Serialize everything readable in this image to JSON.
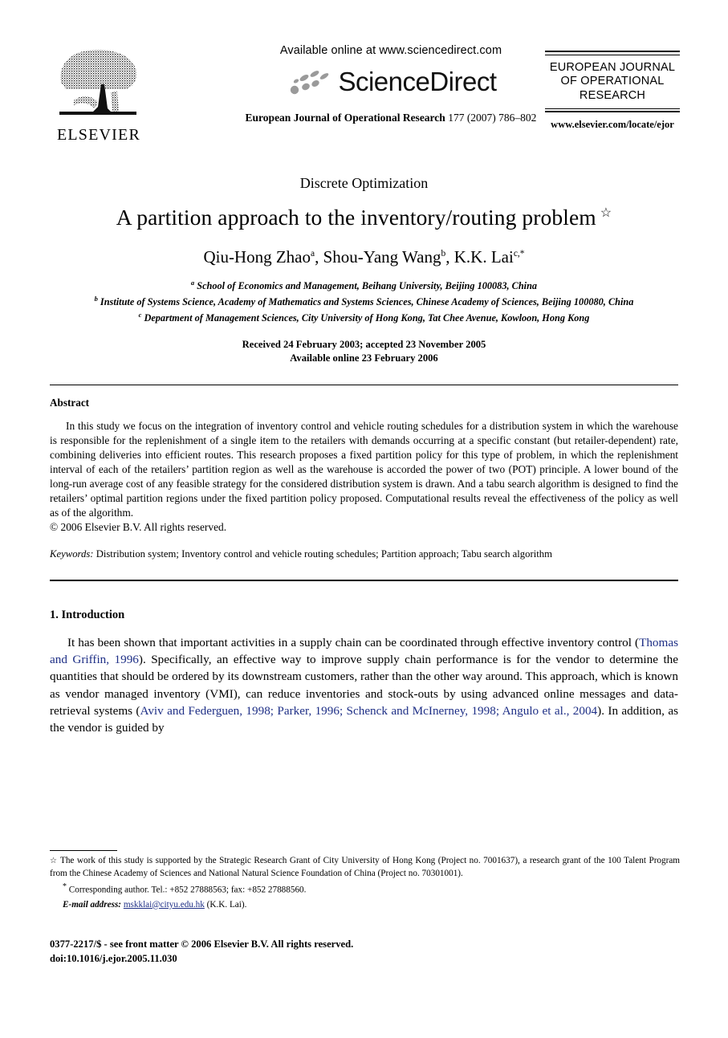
{
  "masthead": {
    "publisher_logo_name": "elsevier-tree-logo",
    "publisher_word": "ELSEVIER",
    "available_online": "Available online at www.sciencedirect.com",
    "sciencedirect_word": "ScienceDirect",
    "journal_ref_name": "European Journal of Operational Research",
    "journal_ref_vol": "177 (2007) 786–802",
    "journal_box_title": "EUROPEAN JOURNAL OF OPERATIONAL RESEARCH",
    "journal_box_url": "www.elsevier.com/locate/ejor"
  },
  "article": {
    "section_label": "Discrete Optimization",
    "title": "A partition approach to the inventory/routing problem",
    "title_footnote_mark": "☆",
    "authors": [
      {
        "name": "Qiu-Hong Zhao",
        "mark": "a"
      },
      {
        "name": "Shou-Yang Wang",
        "mark": "b"
      },
      {
        "name": "K.K. Lai",
        "mark": "c,*"
      }
    ],
    "affiliations": [
      {
        "mark": "a",
        "text": "School of Economics and Management, Beihang University, Beijing 100083, China"
      },
      {
        "mark": "b",
        "text": "Institute of Systems Science, Academy of Mathematics and Systems Sciences, Chinese Academy of Sciences, Beijing 100080, China"
      },
      {
        "mark": "c",
        "text": "Department of Management Sciences, City University of Hong Kong, Tat Chee Avenue, Kowloon, Hong Kong"
      }
    ],
    "received_line": "Received 24 February 2003; accepted 23 November 2005",
    "available_line": "Available online 23 February 2006"
  },
  "abstract": {
    "heading": "Abstract",
    "body": "In this study we focus on the integration of inventory control and vehicle routing schedules for a distribution system in which the warehouse is responsible for the replenishment of a single item to the retailers with demands occurring at a specific constant (but retailer-dependent) rate, combining deliveries into efficient routes. This research proposes a fixed partition policy for this type of problem, in which the replenishment interval of each of the retailers’ partition region as well as the warehouse is accorded the power of two (POT) principle. A lower bound of the long-run average cost of any feasible strategy for the considered distribution system is drawn. And a tabu search algorithm is designed to find the retailers’ optimal partition regions under the fixed partition policy proposed. Computational results reveal the effectiveness of the policy as well as of the algorithm.",
    "copyright": "© 2006 Elsevier B.V. All rights reserved.",
    "keywords_label": "Keywords:",
    "keywords_text": "Distribution system; Inventory control and vehicle routing schedules; Partition approach; Tabu search algorithm"
  },
  "introduction": {
    "heading": "1. Introduction",
    "paragraph_parts": [
      {
        "type": "text",
        "text": "It has been shown that important activities in a supply chain can be coordinated through effective inventory control ("
      },
      {
        "type": "link",
        "text": "Thomas and Griffin, 1996"
      },
      {
        "type": "text",
        "text": "). Specifically, an effective way to improve supply chain performance is for the vendor to determine the quantities that should be ordered by its downstream customers, rather than the other way around. This approach, which is known as vendor managed inventory (VMI), can reduce inventories and stock-outs by using advanced online messages and data-retrieval systems ("
      },
      {
        "type": "link",
        "text": "Aviv and Federguen, 1998; Parker, 1996; Schenck and McInerney, 1998; Angulo et al., 2004"
      },
      {
        "type": "text",
        "text": "). In addition, as the vendor is guided by"
      }
    ]
  },
  "footnotes": {
    "star_mark": "☆",
    "star_text": "The work of this study is supported by the Strategic Research Grant of City University of Hong Kong (Project no. 7001637), a research grant of the 100 Talent Program from the Chinese Academy of Sciences and National Natural Science Foundation of China (Project no. 70301001).",
    "corr_mark": "*",
    "corr_text": "Corresponding author. Tel.: +852 27888563; fax: +852 27888560.",
    "email_label": "E-mail address:",
    "email": "mskklai@cityu.edu.hk",
    "email_suffix": "(K.K. Lai)."
  },
  "footer": {
    "issn_line": "0377-2217/$ - see front matter © 2006 Elsevier B.V. All rights reserved.",
    "doi_line": "doi:10.1016/j.ejor.2005.11.030"
  },
  "colors": {
    "link": "#1e2f86",
    "text": "#000000",
    "background": "#ffffff",
    "sd_swoosh": "#9a9a9a"
  }
}
